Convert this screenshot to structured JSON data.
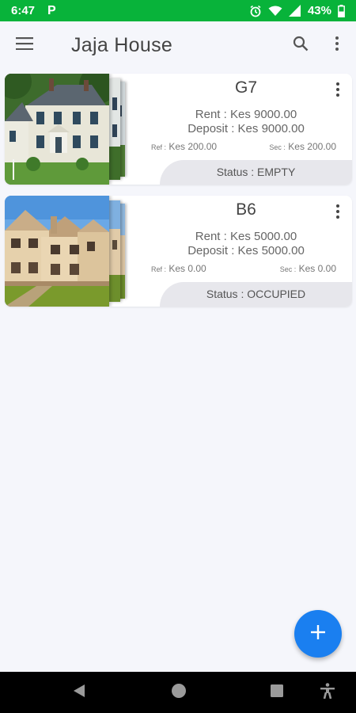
{
  "status_bar": {
    "time": "6:47",
    "notification_letter": "P",
    "battery_percent": "43%",
    "background_color": "#08b33a",
    "icons": [
      "alarm-icon",
      "wifi-icon",
      "signal-icon",
      "battery-icon"
    ]
  },
  "appbar": {
    "title": "Jaja House",
    "icons": [
      "menu-icon",
      "search-icon",
      "more-vert-icon"
    ]
  },
  "units": [
    {
      "name": "G7",
      "rent_label": "Rent : Kes 9000.00",
      "deposit_label": "Deposit : Kes 9000.00",
      "ref_prefix": "Ref :",
      "ref_value": "Kes 200.00",
      "sec_prefix": "Sec :",
      "sec_value": "Kes 200.00",
      "status_label": "Status : EMPTY",
      "image": "white-colonial-house-photo"
    },
    {
      "name": "B6",
      "rent_label": "Rent : Kes 5000.00",
      "deposit_label": "Deposit : Kes 5000.00",
      "ref_prefix": "Ref :",
      "ref_value": "Kes 0.00",
      "sec_prefix": "Sec :",
      "sec_value": "Kes 0.00",
      "status_label": "Status : OCCUPIED",
      "image": "beige-townhouse-photo"
    }
  ],
  "fab": {
    "icon": "plus-icon",
    "color": "#1a7ff0"
  },
  "navbar": {
    "icons": [
      "back-icon",
      "home-icon",
      "recents-icon",
      "accessibility-icon"
    ]
  },
  "colors": {
    "page_background": "#f5f6fb",
    "status_band": "#e7e7ec",
    "text": "#555555"
  }
}
